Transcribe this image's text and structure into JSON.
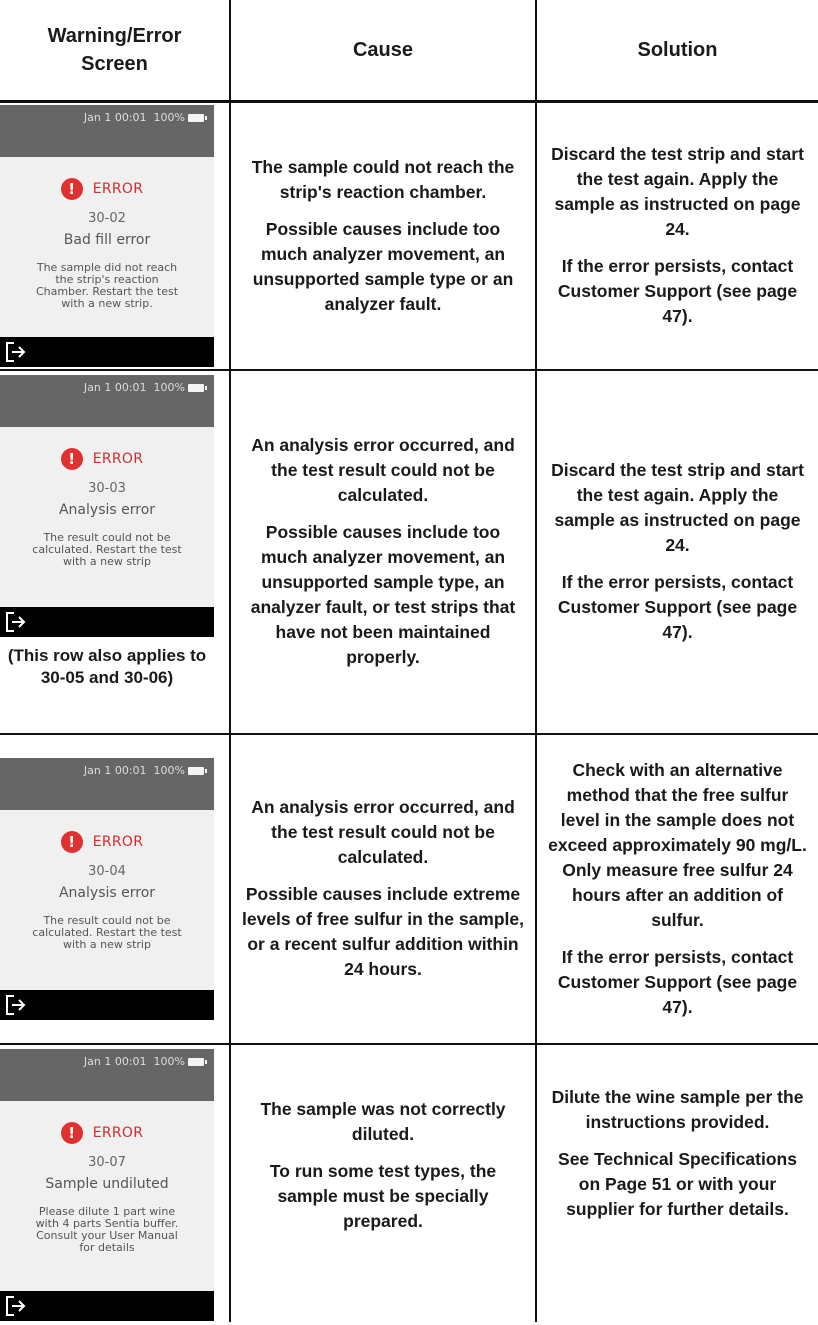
{
  "header": {
    "col1": "Warning/Error\nScreen",
    "col2": "Cause",
    "col3": "Solution"
  },
  "rows": [
    {
      "screen": {
        "date": "Jan  1  00:01",
        "battery": "100%",
        "label": "ERROR",
        "code": "30-02",
        "title": "Bad fill error",
        "message": "The sample did not reach the strip's reaction Chamber. Restart the test with a new strip."
      },
      "note": "",
      "cause": [
        "The sample could not reach the strip's reaction chamber.",
        "Possible causes include too much analyzer movement, an unsupported sample type or an analyzer fault."
      ],
      "solution": [
        "Discard the test strip and start the test again. Apply the sample as instructed on page 24.",
        "If the error persists, contact Customer Support (see page 47)."
      ]
    },
    {
      "screen": {
        "date": "Jan  1  00:01",
        "battery": "100%",
        "label": "ERROR",
        "code": "30-03",
        "title": "Analysis error",
        "message": "The result could not be calculated. Restart the test with a new strip"
      },
      "note": "(This row also applies to 30-05 and 30-06)",
      "cause": [
        "An analysis error occurred, and the test result could not be calculated.",
        "Possible causes include too much analyzer movement, an unsupported sample type, an analyzer fault, or test strips that have not been maintained properly."
      ],
      "solution": [
        "Discard the test strip and start the test again. Apply the sample as instructed on page 24.",
        "If the error persists, contact Customer Support (see page 47)."
      ]
    },
    {
      "screen": {
        "date": "Jan  1  00:01",
        "battery": "100%",
        "label": "ERROR",
        "code": "30-04",
        "title": "Analysis error",
        "message": "The result could not be calculated. Restart the test with a new strip"
      },
      "note": "",
      "cause": [
        "An analysis error occurred, and the test result could not be calculated.",
        "Possible causes include extreme levels of free sulfur in the sample, or a recent sulfur addition within 24 hours."
      ],
      "solution": [
        "Check with an alternative method that the free sulfur level in the sample does not exceed approximately 90 mg/L. Only measure free sulfur 24 hours after an addition of sulfur.",
        "If the error persists, contact Customer Support (see page 47)."
      ]
    },
    {
      "screen": {
        "date": "Jan  1  00:01",
        "battery": "100%",
        "label": "ERROR",
        "code": "30-07",
        "title": "Sample undiluted",
        "message": "Please dilute 1 part wine with 4 parts Sentia buffer. Consult your User Manual for details"
      },
      "note": "",
      "cause": [
        "The sample was not correctly diluted.",
        "To run some test types, the sample must be specially prepared."
      ],
      "solution": [
        "Dilute the wine sample per the instructions provided.",
        "See Technical Specifications on Page 51 or with your supplier for further details."
      ]
    }
  ]
}
